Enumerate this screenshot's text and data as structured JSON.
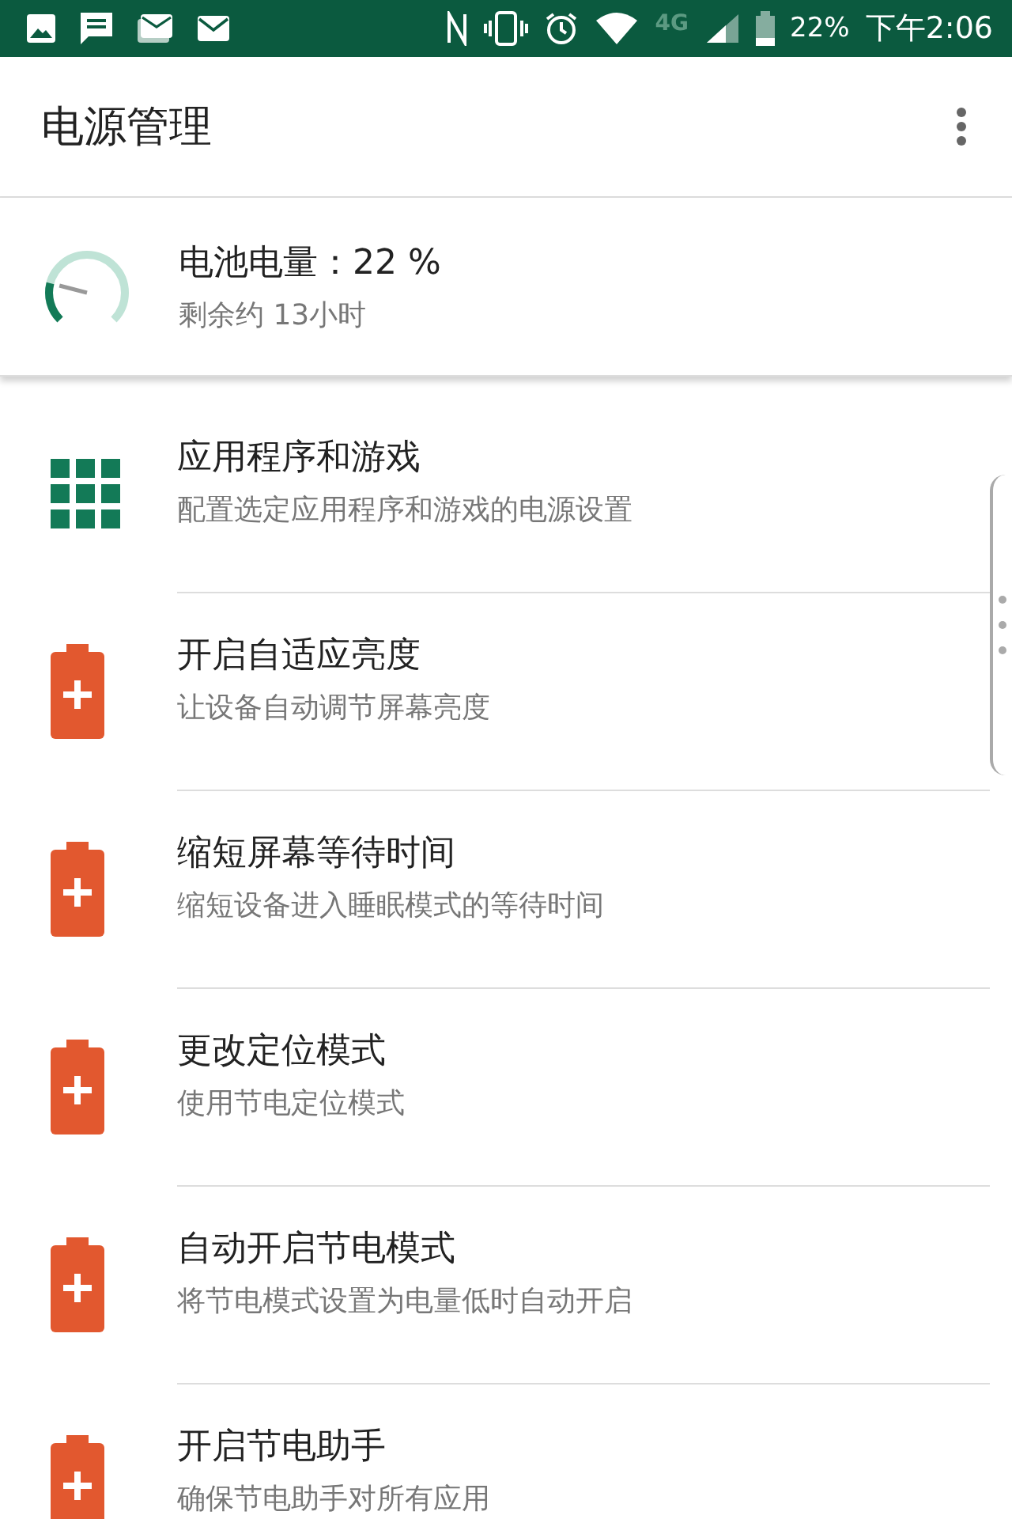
{
  "status_bar": {
    "network": "4G",
    "battery": "22%",
    "time": "下午2:06"
  },
  "app_bar": {
    "title": "电源管理"
  },
  "battery_card": {
    "title": "电池电量：22 %",
    "subtitle": "剩余约 13小时"
  },
  "items": [
    {
      "kind": "grid",
      "title": "应用程序和游戏",
      "subtitle": "配置选定应用程序和游戏的电源设置"
    },
    {
      "kind": "battery",
      "title": "开启自适应亮度",
      "subtitle": "让设备自动调节屏幕亮度"
    },
    {
      "kind": "battery",
      "title": "缩短屏幕等待时间",
      "subtitle": "缩短设备进入睡眠模式的等待时间"
    },
    {
      "kind": "battery",
      "title": "更改定位模式",
      "subtitle": "使用节电定位模式"
    },
    {
      "kind": "battery",
      "title": "自动开启节电模式",
      "subtitle": "将节电模式设置为电量低时自动开启"
    },
    {
      "kind": "battery",
      "title": "开启节电助手",
      "subtitle": "确保节电助手对所有应用"
    }
  ]
}
